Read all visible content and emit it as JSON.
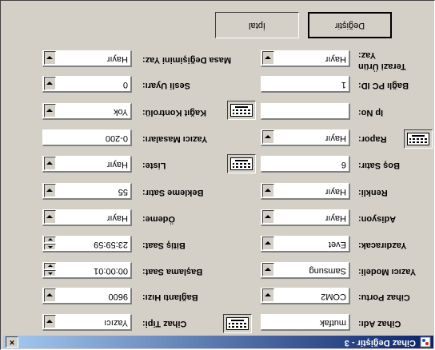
{
  "window": {
    "title": "Cihaz Değiştir - 3",
    "close_glyph": "×"
  },
  "left": {
    "cihaz_adi": {
      "label": "Cihaz Adı:",
      "value": "mutfak"
    },
    "cihaz_portu": {
      "label": "Cihaz Portu:",
      "value": "COM2"
    },
    "yazici_modeli": {
      "label": "Yazıcı Modeli:",
      "value": "Samsung"
    },
    "yazdiracak": {
      "label": "Yazdıracak:",
      "value": "Evet"
    },
    "adisyon": {
      "label": "Adisyon:",
      "value": "Hayır"
    },
    "renkli": {
      "label": "Renkli:",
      "value": "Hayır"
    },
    "bos_satir": {
      "label": "Boş Satır:",
      "value": "6"
    },
    "rapor": {
      "label": "Rapor:",
      "value": "Hayır"
    },
    "ip_no": {
      "label": "Ip No:",
      "value": ""
    },
    "bagli_pc_id": {
      "label": "Bağlı PC ID:",
      "value": "1"
    },
    "terazi_urun": {
      "label_line1": "Terazi Ürün",
      "label_line2": "Yaz:",
      "value": "Hayır"
    }
  },
  "right": {
    "cihaz_tipi": {
      "label": "Cihaz Tipi:",
      "value": "Yazıcı"
    },
    "baglanti_hizi": {
      "label": "Bağlantı Hızı:",
      "value": "9600"
    },
    "baslama_saat": {
      "label": "Başlama Saat:",
      "value": "00:00:01"
    },
    "bitis_saat": {
      "label": "Bitiş Saat:",
      "value": "23:59:59"
    },
    "odeme": {
      "label": "Ödeme:",
      "value": "Hayır"
    },
    "bekleme_satir": {
      "label": "Bekleme Satır:",
      "value": "55"
    },
    "liste": {
      "label": "Liste:",
      "value": "Hayır"
    },
    "yazici_masalari": {
      "label": "Yazıcı Masaları:",
      "value": "0-200"
    },
    "kagit_kontrolu": {
      "label": "Kağıt Kontrolü:",
      "value": "Yok"
    },
    "sesli_uyari": {
      "label": "Sesli Uyarı:",
      "value": "0"
    },
    "masa_degisimini_yaz": {
      "label": "Masa Değişimini Yaz:",
      "value": "Hayır"
    }
  },
  "buttons": {
    "degistir": "Değiştir",
    "iptal": "İptal"
  }
}
